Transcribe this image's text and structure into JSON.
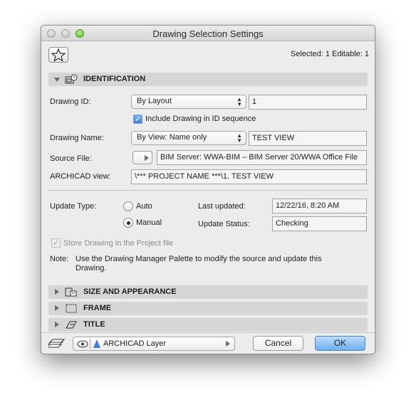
{
  "window": {
    "title": "Drawing Selection Settings"
  },
  "header": {
    "selection": "Selected: 1 Editable: 1"
  },
  "identification": {
    "section_label": "IDENTIFICATION",
    "drawing_id": {
      "label": "Drawing ID:",
      "mode": "By Layout",
      "value": "1"
    },
    "include_in_sequence": {
      "label": "Include Drawing in ID sequence",
      "checked": true
    },
    "drawing_name": {
      "label": "Drawing Name:",
      "mode": "By View: Name only",
      "value": "TEST VIEW"
    },
    "source_file": {
      "label": "Source File:",
      "value": "BIM Server: WWA-BIM – BIM Server 20/WWA Office File"
    },
    "archicad_view": {
      "label": "ARCHICAD view:",
      "value": "\\*** PROJECT NAME ***\\1. TEST VIEW"
    },
    "update_type": {
      "label": "Update Type:",
      "options": [
        "Auto",
        "Manual"
      ],
      "selected": "Manual"
    },
    "last_updated": {
      "label": "Last updated:",
      "value": "12/22/16, 8:20 AM"
    },
    "update_status": {
      "label": "Update Status:",
      "value": "Checking"
    },
    "store_drawing": {
      "label": "Store Drawing in the Project file",
      "checked": true,
      "enabled": false
    },
    "note": {
      "prefix": "Note:",
      "line1": "Use the Drawing Manager Palette to modify the source and update this",
      "line2": "Drawing."
    }
  },
  "sections": [
    {
      "label": "SIZE AND APPEARANCE",
      "icon": "size-appearance-icon"
    },
    {
      "label": "FRAME",
      "icon": "frame-icon"
    },
    {
      "label": "TITLE",
      "icon": "title-icon"
    }
  ],
  "footer": {
    "layer": "ARCHICAD Layer",
    "cancel": "Cancel",
    "ok": "OK"
  },
  "colors": {
    "accent": "#6eb0ef",
    "section_bar": "#d5d5d5",
    "window_bg": "#ececec"
  }
}
